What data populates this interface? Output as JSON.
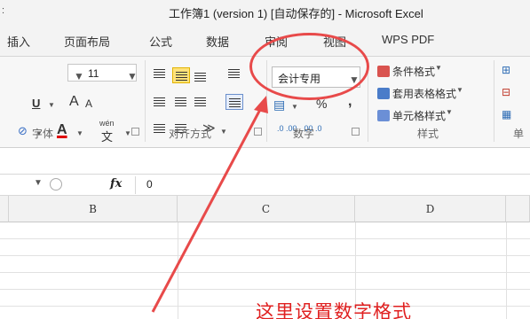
{
  "titlebar": {
    "left_fragment": ":",
    "title": "工作簿1 (version 1) [自动保存的] - Microsoft Excel"
  },
  "tabs": [
    "插入",
    "页面布局",
    "公式",
    "数据",
    "审阅",
    "视图",
    "WPS PDF"
  ],
  "ribbon": {
    "font": {
      "size_value": "11",
      "underline_label": "U",
      "grow_font": "A",
      "shrink_font": "A",
      "font_color_letter": "A",
      "phonetic": "wén",
      "phonetic_char": "文",
      "group_label": "字体"
    },
    "alignment": {
      "group_label": "对齐方式"
    },
    "number": {
      "format_value": "会计专用",
      "percent": "%",
      "comma": ",",
      "inc_decimal": ".0 .00",
      "dec_decimal": ".00 .0",
      "group_label": "数字"
    },
    "styles": {
      "conditional_format": "条件格式",
      "table_format": "套用表格格式",
      "cell_styles": "单元格样式",
      "group_label": "样式"
    },
    "cells": {
      "group_label": "单"
    }
  },
  "formula_bar": {
    "fx_label": "fx",
    "value": "0"
  },
  "grid": {
    "columns": [
      "B",
      "C",
      "D"
    ]
  },
  "annotation": {
    "text": "这里设置数字格式"
  },
  "colors": {
    "highlight": "#ffe27a",
    "annotation": "#e02020"
  }
}
